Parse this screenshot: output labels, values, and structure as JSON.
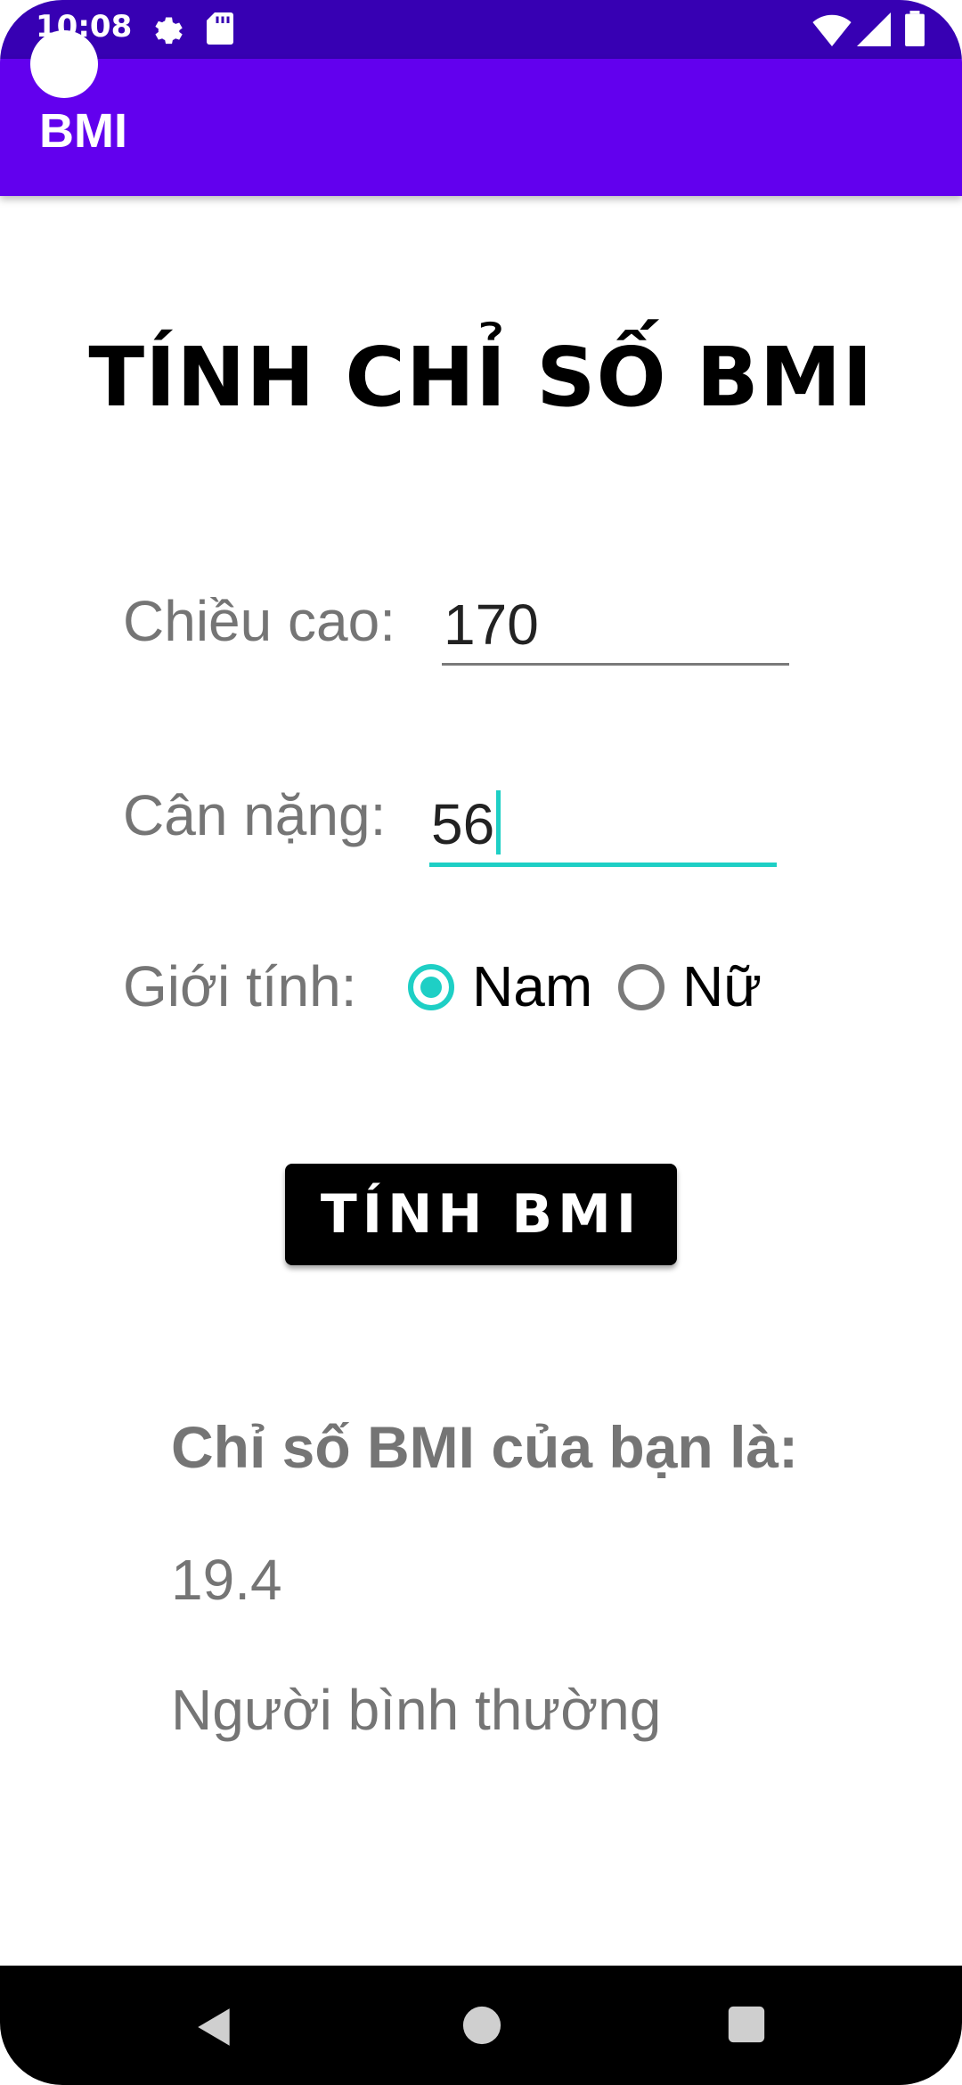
{
  "status_bar": {
    "time": "10:08",
    "icons": [
      "gear-icon",
      "sd-card-icon",
      "wifi-icon",
      "signal-icon",
      "battery-icon"
    ],
    "background": "#3700B3"
  },
  "app_bar": {
    "title": "BMI",
    "background": "#6200EE"
  },
  "main": {
    "title": "TÍNH CHỈ SỐ BMI",
    "height": {
      "label": "Chiều cao:",
      "value": "170"
    },
    "weight": {
      "label": "Cân nặng:",
      "value": "56"
    },
    "gender": {
      "label": "Giới tính:",
      "options": [
        {
          "label": "Nam",
          "checked": true
        },
        {
          "label": "Nữ",
          "checked": false
        }
      ]
    },
    "calculate_button": "TÍNH BMI",
    "result": {
      "heading": "Chỉ số BMI của bạn là:",
      "value": "19.4",
      "status": "Người bình thường"
    },
    "accent_color": "#1ECFC5"
  },
  "nav_bar": {
    "icons": [
      "back-icon",
      "home-icon",
      "recents-icon"
    ]
  }
}
